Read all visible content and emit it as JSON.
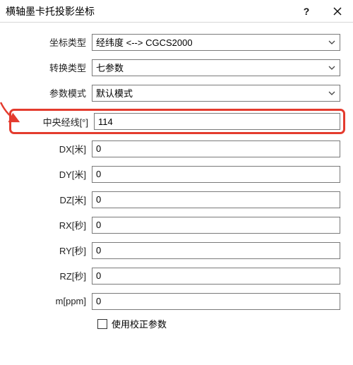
{
  "titlebar": {
    "title": "横轴墨卡托投影坐标",
    "help_label": "?"
  },
  "form": {
    "coord_type": {
      "label": "坐标类型",
      "value": "经纬度 <--> CGCS2000"
    },
    "trans_type": {
      "label": "转换类型",
      "value": "七参数"
    },
    "param_mode": {
      "label": "参数模式",
      "value": "默认模式"
    },
    "central_meridian": {
      "label": "中央经线[°]",
      "value": "114"
    },
    "dx": {
      "label": "DX[米]",
      "value": "0"
    },
    "dy": {
      "label": "DY[米]",
      "value": "0"
    },
    "dz": {
      "label": "DZ[米]",
      "value": "0"
    },
    "rx": {
      "label": "RX[秒]",
      "value": "0"
    },
    "ry": {
      "label": "RY[秒]",
      "value": "0"
    },
    "rz": {
      "label": "RZ[秒]",
      "value": "0"
    },
    "m": {
      "label": "m[ppm]",
      "value": "0"
    },
    "use_correction": {
      "label": "使用校正参数",
      "checked": false
    }
  }
}
